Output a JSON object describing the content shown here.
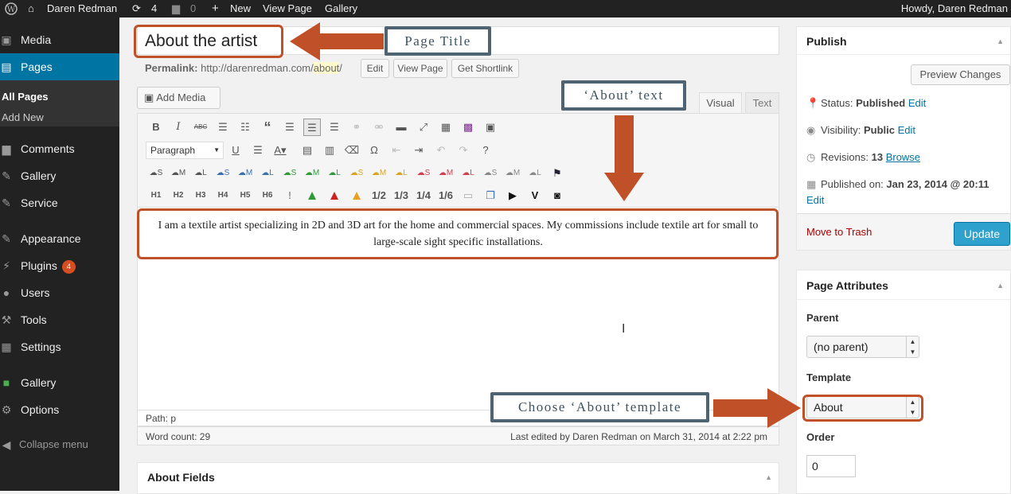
{
  "adminbar": {
    "site_name": "Daren Redman",
    "updates_count": "4",
    "comments_count": "0",
    "new_label": "New",
    "view_page": "View Page",
    "gallery": "Gallery",
    "howdy": "Howdy, Daren Redman"
  },
  "sidebar": {
    "items": [
      {
        "label": "Media",
        "icon": "media-icon"
      },
      {
        "label": "Pages",
        "icon": "pages-icon"
      },
      {
        "label": "Comments",
        "icon": "comments-icon"
      },
      {
        "label": "Gallery",
        "icon": "gallery-icon"
      },
      {
        "label": "Service",
        "icon": "pin-icon"
      },
      {
        "label": "Appearance",
        "icon": "appearance-icon"
      },
      {
        "label": "Plugins",
        "icon": "plugins-icon",
        "badge": "4"
      },
      {
        "label": "Users",
        "icon": "users-icon"
      },
      {
        "label": "Tools",
        "icon": "tools-icon"
      },
      {
        "label": "Settings",
        "icon": "settings-icon"
      },
      {
        "label": "Gallery",
        "icon": "gallery-green-icon"
      },
      {
        "label": "Options",
        "icon": "gear-icon"
      }
    ],
    "submenu": [
      "All Pages",
      "Add New"
    ],
    "collapse": "Collapse menu"
  },
  "editor": {
    "title": "About the artist",
    "permalink_label": "Permalink:",
    "permalink_base": "http://darenredman.com/",
    "permalink_slug": "about",
    "permalink_end": "/",
    "edit_btn": "Edit",
    "view_page_btn": "View Page",
    "shortlink_btn": "Get Shortlink",
    "add_media": "Add Media",
    "tab_visual": "Visual",
    "tab_text": "Text",
    "format_select": "Paragraph",
    "headings": [
      "H1",
      "H2",
      "H3",
      "H4",
      "H5",
      "H6"
    ],
    "fractions": [
      "1/2",
      "1/3",
      "1/4",
      "1/6"
    ],
    "content": "I am a textile artist specializing in 2D and 3D art for the home and commercial spaces. My commissions include textile art for small to large-scale sight specific installations.",
    "path": "Path: p",
    "word_count": "Word count: 29",
    "last_edited": "Last edited by Daren Redman on March 31, 2014 at 2:22 pm"
  },
  "about_fields": {
    "title": "About Fields"
  },
  "publish": {
    "title": "Publish",
    "preview": "Preview Changes",
    "status_label": "Status:",
    "status_value": "Published",
    "visibility_label": "Visibility:",
    "visibility_value": "Public",
    "revisions_label": "Revisions:",
    "revisions_value": "13",
    "browse": "Browse",
    "published_label": "Published on:",
    "published_value": "Jan 23, 2014 @ 20:11",
    "edit": "Edit",
    "trash": "Move to Trash",
    "update": "Update"
  },
  "page_attributes": {
    "title": "Page Attributes",
    "parent_label": "Parent",
    "parent_value": "(no parent)",
    "template_label": "Template",
    "template_value": "About",
    "order_label": "Order",
    "order_value": "0"
  },
  "annotations": {
    "page_title": "Page Title",
    "about_text": "‘About’ text",
    "choose_template": "Choose ‘About’ template"
  },
  "colors": {
    "admin_dark": "#222222",
    "accent_blue": "#0074a2",
    "annotation_orange": "#c05028",
    "annotation_slate": "#4e6473"
  }
}
